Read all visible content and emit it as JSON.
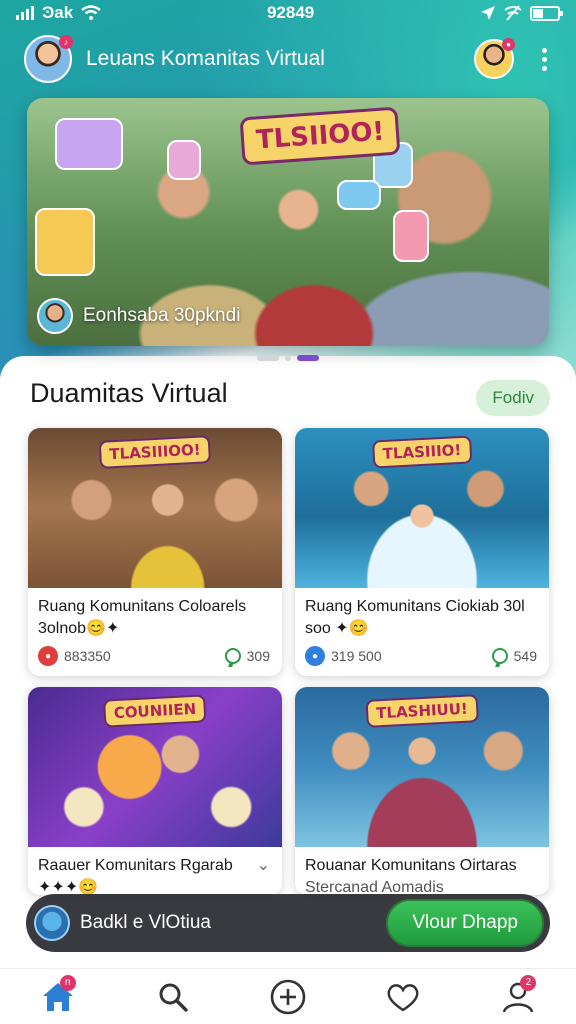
{
  "status_bar": {
    "carrier": "Ͽak",
    "time": "92849"
  },
  "header": {
    "title": "Leuans Komanitas Virtual",
    "avatar_badge": "♪",
    "avatar2_badge": "●"
  },
  "hero": {
    "banner_text": "TLSIIOO!",
    "caption": "Eonhsaba 30pkndi"
  },
  "section": {
    "title": "Duamitas Virtual",
    "chip_label": "Fodiv"
  },
  "cards": [
    {
      "badge": "TLASIIIOO!",
      "title": "Ruang Komunitans Coloarels 3olnob😊✦",
      "meta_left": "883350",
      "meta_right": "309"
    },
    {
      "badge": "TLASIIIO!",
      "title": "Ruang Komunitans Ciokiab 30l soo ✦😊",
      "meta_left": "319 500",
      "meta_right": "549"
    },
    {
      "badge": "COUNIIEN",
      "title": "Raauer Komunitars Rgarab ✦✦✦😊"
    },
    {
      "badge": "TLASHIUU!",
      "title": "Rouanar Komunitans Oirtaras",
      "subtitle": "Stercanad Aomadis"
    }
  ],
  "cta": {
    "text": "Badkl e VlOtiua",
    "button_label": "Vlour Dhapp"
  },
  "bottom_nav": {
    "home_badge": "n",
    "profile_badge": "2"
  },
  "colors": {
    "accent_teal": "#1da7a0",
    "accent_purple": "#7a4ad2",
    "cta_green": "#2fae4c",
    "badge_pink": "#e0356b"
  }
}
